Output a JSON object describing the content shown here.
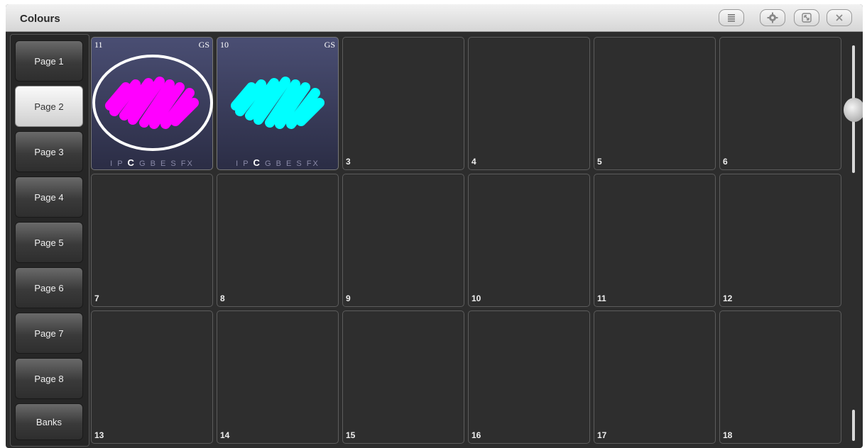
{
  "window": {
    "title": "Colours",
    "buttons": [
      {
        "name": "list-button",
        "icon": "list-icon"
      },
      {
        "name": "settings-button",
        "icon": "gear-icon"
      },
      {
        "name": "resize-button",
        "icon": "resize-icon"
      },
      {
        "name": "close-button",
        "icon": "close-icon"
      }
    ]
  },
  "sidebar": {
    "items": [
      {
        "label": "Page 1",
        "active": false
      },
      {
        "label": "Page 2",
        "active": true
      },
      {
        "label": "Page 3",
        "active": false
      },
      {
        "label": "Page 4",
        "active": false
      },
      {
        "label": "Page 5",
        "active": false
      },
      {
        "label": "Page 6",
        "active": false
      },
      {
        "label": "Page 7",
        "active": false
      },
      {
        "label": "Page 8",
        "active": false
      },
      {
        "label": "Banks",
        "active": false
      }
    ]
  },
  "palettes": [
    {
      "number": "11",
      "tag": "GS",
      "attrs": [
        "I",
        "P",
        "C",
        "G",
        "B",
        "E",
        "S",
        "FX"
      ],
      "highlight": "C",
      "color": "#ff00ff",
      "circled": true
    },
    {
      "number": "10",
      "tag": "GS",
      "attrs": [
        "I",
        "P",
        "C",
        "G",
        "B",
        "E",
        "S",
        "FX"
      ],
      "highlight": "C",
      "color": "#00ffff",
      "circled": false
    },
    {
      "number": "3"
    },
    {
      "number": "4"
    },
    {
      "number": "5"
    },
    {
      "number": "6"
    },
    {
      "number": "7"
    },
    {
      "number": "8"
    },
    {
      "number": "9"
    },
    {
      "number": "10"
    },
    {
      "number": "11"
    },
    {
      "number": "12"
    },
    {
      "number": "13"
    },
    {
      "number": "14"
    },
    {
      "number": "15"
    },
    {
      "number": "16"
    },
    {
      "number": "17"
    },
    {
      "number": "18"
    }
  ]
}
